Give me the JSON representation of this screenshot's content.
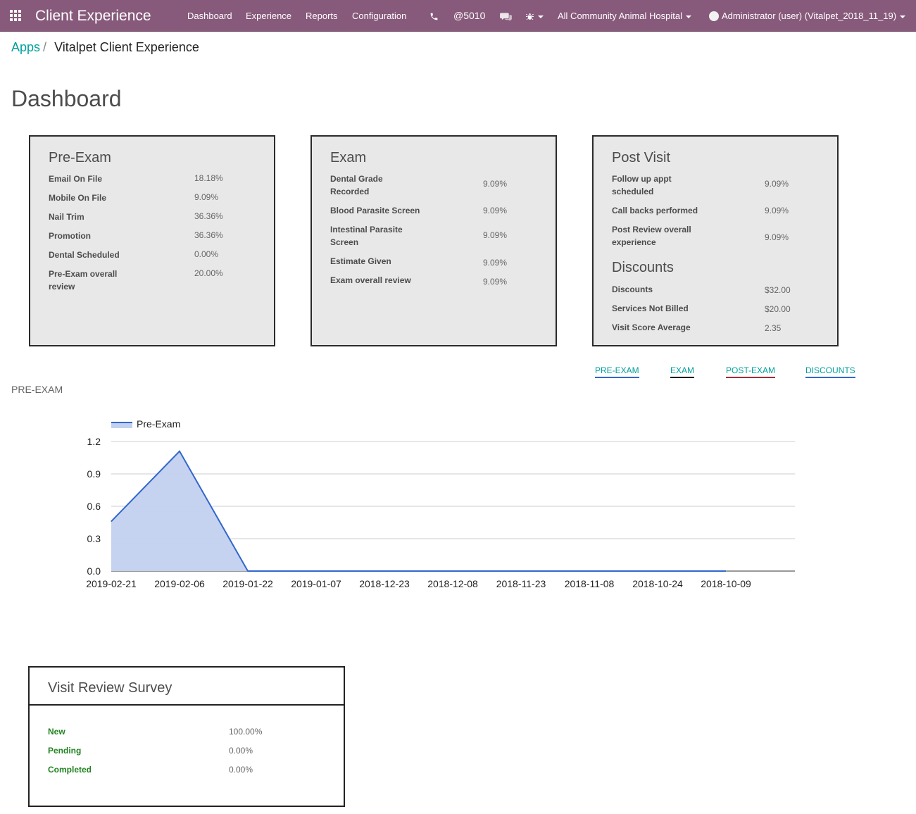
{
  "navbar": {
    "app_name": "Client Experience",
    "menu": [
      "Dashboard",
      "Experience",
      "Reports",
      "Configuration"
    ],
    "phone_icon": "phone-icon",
    "extension": "@5010",
    "chat_icon": "chat-icon",
    "debug_icon": "bug-icon",
    "company": "All Community Animal Hospital",
    "user": "Administrator (user) (Vitalpet_2018_11_19)"
  },
  "breadcrumb": {
    "parent": "Apps",
    "current": "Vitalpet Client Experience"
  },
  "page_title": "Dashboard",
  "cards": {
    "pre_exam": {
      "title": "Pre-Exam",
      "rows": [
        {
          "label": "Email On File",
          "value": "18.18%"
        },
        {
          "label": "Mobile On File",
          "value": "9.09%"
        },
        {
          "label": "Nail Trim",
          "value": "36.36%"
        },
        {
          "label": "Promotion",
          "value": "36.36%"
        },
        {
          "label": "Dental Scheduled",
          "value": "0.00%"
        },
        {
          "label": "Pre-Exam overall review",
          "value": "20.00%"
        }
      ]
    },
    "exam": {
      "title": "Exam",
      "rows": [
        {
          "label": "Dental Grade Recorded",
          "value": "9.09%"
        },
        {
          "label": "Blood Parasite Screen",
          "value": "9.09%"
        },
        {
          "label": "Intestinal Parasite Screen",
          "value": "9.09%"
        },
        {
          "label": "Estimate Given",
          "value": "9.09%"
        },
        {
          "label": "Exam overall review",
          "value": "9.09%"
        }
      ]
    },
    "post_visit": {
      "title": "Post Visit",
      "rows": [
        {
          "label": "Follow up appt scheduled",
          "value": "9.09%"
        },
        {
          "label": "Call backs performed",
          "value": "9.09%"
        },
        {
          "label": "Post Review overall experience",
          "value": "9.09%"
        }
      ],
      "discounts_title": "Discounts",
      "discount_rows": [
        {
          "label": "Discounts",
          "value": "$32.00"
        },
        {
          "label": "Services Not Billed",
          "value": "$20.00"
        },
        {
          "label": "Visit Score Average",
          "value": "2.35"
        }
      ]
    }
  },
  "tabs": [
    {
      "label": "PRE-EXAM",
      "color": "#00a09d",
      "underline": "#3366cc"
    },
    {
      "label": "EXAM",
      "color": "#00a09d",
      "underline": "#111111"
    },
    {
      "label": "POST-EXAM",
      "color": "#00a09d",
      "underline": "#a52a3a"
    },
    {
      "label": "DISCOUNTS",
      "color": "#00a09d",
      "underline": "#3366cc"
    }
  ],
  "section_label": "PRE-EXAM",
  "chart_data": {
    "type": "area",
    "series": [
      {
        "name": "Pre-Exam",
        "color": "#3366cc",
        "fill": "#c2d1ef",
        "values": [
          0.46,
          1.11,
          0,
          0,
          0,
          0,
          0,
          0,
          0,
          0
        ]
      }
    ],
    "categories": [
      "2019-02-21",
      "2019-02-06",
      "2019-01-22",
      "2019-01-07",
      "2018-12-23",
      "2018-12-08",
      "2018-11-23",
      "2018-11-08",
      "2018-10-24",
      "2018-10-09"
    ],
    "yticks": [
      "0.0",
      "0.3",
      "0.6",
      "0.9",
      "1.2"
    ],
    "ylim": [
      0,
      1.2
    ],
    "grid": true,
    "legend": "top-left"
  },
  "survey": {
    "title": "Visit Review Survey",
    "rows": [
      {
        "label": "New",
        "value": "100.00%"
      },
      {
        "label": "Pending",
        "value": "0.00%"
      },
      {
        "label": "Completed",
        "value": "0.00%"
      }
    ]
  }
}
